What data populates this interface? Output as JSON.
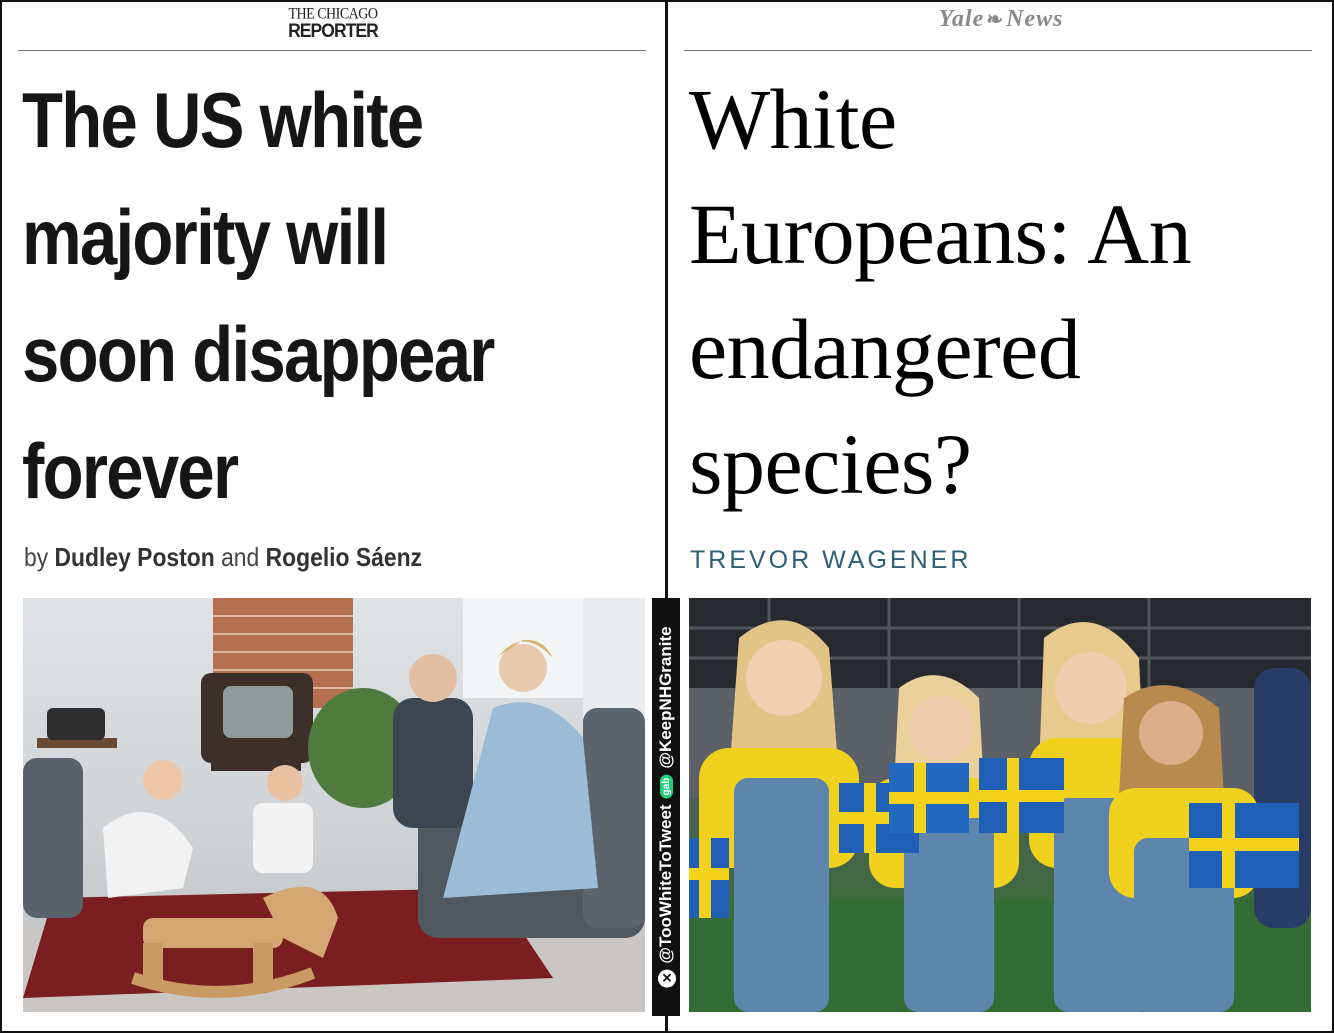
{
  "left": {
    "logo_line1": "THE CHICAGO",
    "logo_line2": "REPORTER",
    "headline_lines": [
      "The US white",
      "majority will",
      "soon disappear",
      "forever"
    ],
    "byline_prefix": "by",
    "author1": "Dudley Poston",
    "byline_and": "and",
    "author2": "Rogelio Sáenz"
  },
  "right": {
    "logo_part1": "Yale",
    "logo_part2": "News",
    "headline_lines": [
      "White",
      "Europeans: An",
      "endangered",
      "species?"
    ],
    "author": "TREVOR WAGENER"
  },
  "watermark": {
    "handle1": "@TooWhiteToTweet",
    "gab_label": "gab",
    "handle2": "@KeepNHGranite",
    "x_icon": "✕"
  },
  "colors": {
    "author_teal": "#2f5f74",
    "yale_grey": "#8a8a8a",
    "swedish_blue": "#1f5fb5",
    "swedish_yellow": "#f3d21b"
  }
}
